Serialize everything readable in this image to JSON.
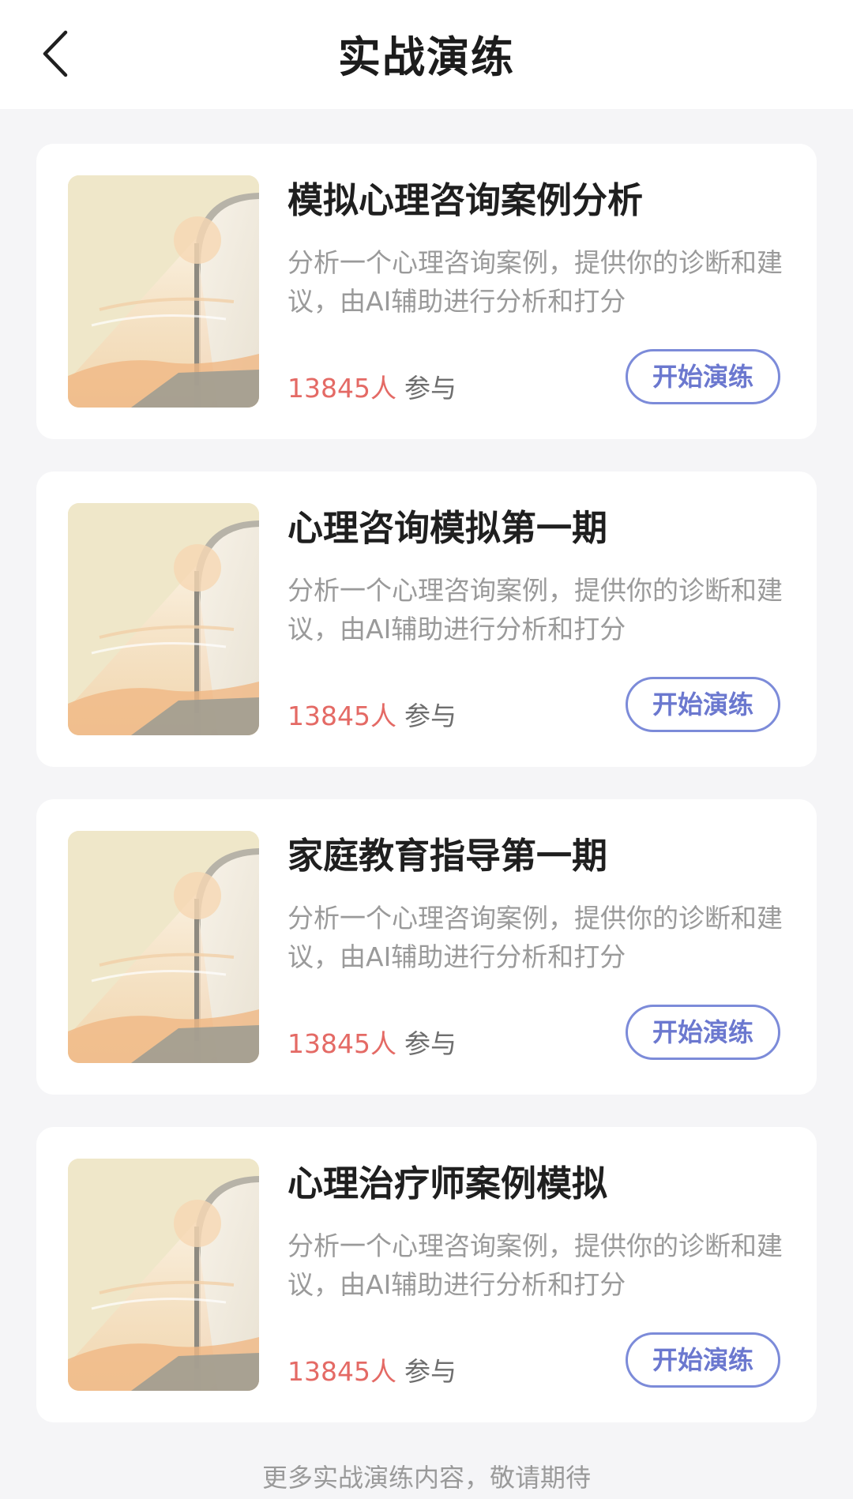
{
  "header": {
    "title": "实战演练",
    "back_icon": "chevron-left-icon"
  },
  "cards": [
    {
      "title": "模拟心理咨询案例分析",
      "description": "分析一个心理咨询案例，提供你的诊断和建议，由AI辅助进行分析和打分",
      "participants": "13845人",
      "participants_suffix": "参与",
      "button_label": "开始演练"
    },
    {
      "title": "心理咨询模拟第一期",
      "description": "分析一个心理咨询案例，提供你的诊断和建议，由AI辅助进行分析和打分",
      "participants": "13845人",
      "participants_suffix": "参与",
      "button_label": "开始演练"
    },
    {
      "title": "家庭教育指导第一期",
      "description": "分析一个心理咨询案例，提供你的诊断和建议，由AI辅助进行分析和打分",
      "participants": "13845人",
      "participants_suffix": "参与",
      "button_label": "开始演练"
    },
    {
      "title": "心理治疗师案例模拟",
      "description": "分析一个心理咨询案例，提供你的诊断和建议，由AI辅助进行分析和打分",
      "participants": "13845人",
      "participants_suffix": "参与",
      "button_label": "开始演练"
    }
  ],
  "footer": {
    "note": "更多实战演练内容，敬请期待"
  },
  "colors": {
    "page_background": "#f5f5f7",
    "card_background": "#ffffff",
    "accent": "#7c8bd9",
    "count": "#e46a65",
    "muted_text": "#9a9a9a"
  }
}
